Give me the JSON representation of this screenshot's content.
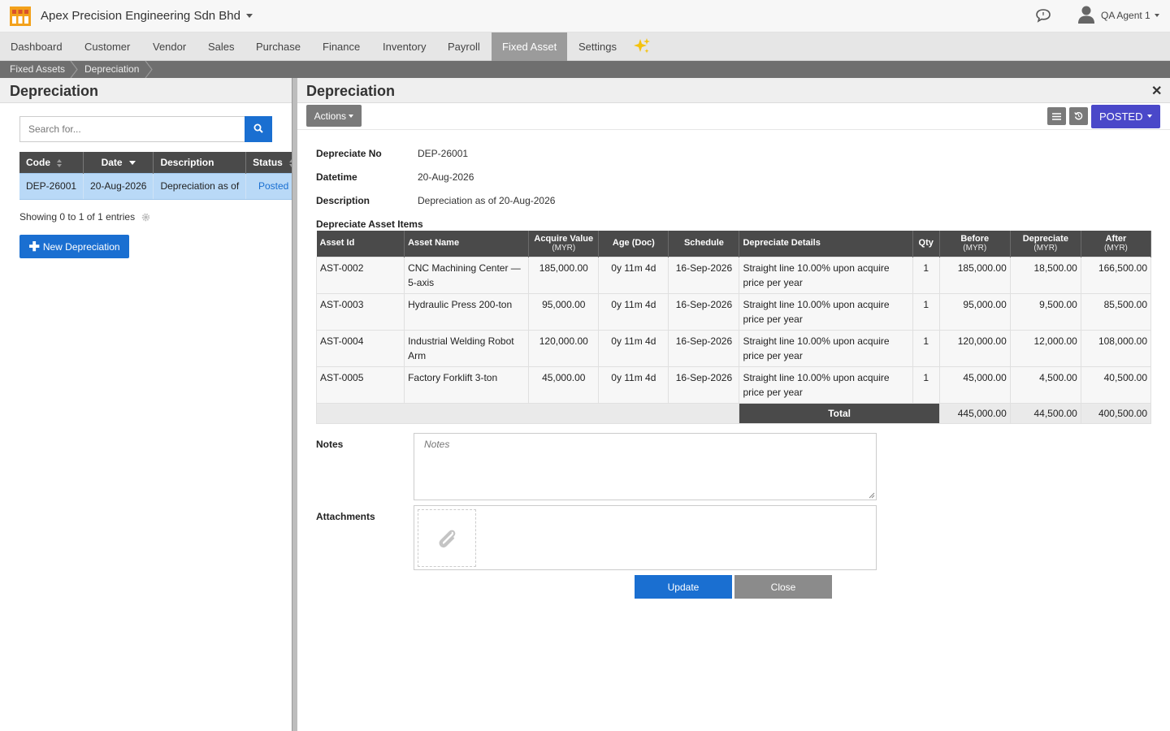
{
  "header": {
    "company": "Apex Precision Engineering Sdn Bhd",
    "user": "QA Agent 1",
    "colors": {
      "primary": "#1a6fd1",
      "posted": "#4a48c9"
    }
  },
  "nav": {
    "items": [
      "Dashboard",
      "Customer",
      "Vendor",
      "Sales",
      "Purchase",
      "Finance",
      "Inventory",
      "Payroll",
      "Fixed Asset",
      "Settings"
    ],
    "active": "Fixed Asset"
  },
  "breadcrumb": [
    "Fixed Assets",
    "Depreciation"
  ],
  "left": {
    "title": "Depreciation",
    "search_placeholder": "Search for...",
    "columns": [
      "Code",
      "Date",
      "Description",
      "Status"
    ],
    "rows": [
      {
        "code": "DEP-26001",
        "date": "20-Aug-2026",
        "description": "Depreciation as of",
        "status": "Posted"
      }
    ],
    "showing": "Showing 0 to 1 of 1 entries",
    "new_button": "New Depreciation"
  },
  "right": {
    "title": "Depreciation",
    "actions_label": "Actions",
    "status_label": "POSTED",
    "fields": {
      "no_label": "Depreciate No",
      "no_value": "DEP-26001",
      "datetime_label": "Datetime",
      "datetime_value": "20-Aug-2026",
      "desc_label": "Description",
      "desc_value": "Depreciation as of 20-Aug-2026"
    },
    "items_title": "Depreciate Asset Items",
    "columns": {
      "asset_id": "Asset Id",
      "asset_name": "Asset Name",
      "acquire": "Acquire Value",
      "acquire_unit": "(MYR)",
      "age": "Age (Doc)",
      "schedule": "Schedule",
      "details": "Depreciate Details",
      "qty": "Qty",
      "before": "Before",
      "before_unit": "(MYR)",
      "depreciate": "Depreciate",
      "depreciate_unit": "(MYR)",
      "after": "After",
      "after_unit": "(MYR)"
    },
    "items": [
      {
        "asset_id": "AST-0002",
        "name": "CNC Machining Center — 5-axis",
        "acquire": "185,000.00",
        "age": "0y 11m 4d",
        "schedule": "16-Sep-2026",
        "details": "Straight line 10.00% upon acquire price per year",
        "qty": "1",
        "before": "185,000.00",
        "depreciate": "18,500.00",
        "after": "166,500.00"
      },
      {
        "asset_id": "AST-0003",
        "name": "Hydraulic Press 200-ton",
        "acquire": "95,000.00",
        "age": "0y 11m 4d",
        "schedule": "16-Sep-2026",
        "details": "Straight line 10.00% upon acquire price per year",
        "qty": "1",
        "before": "95,000.00",
        "depreciate": "9,500.00",
        "after": "85,500.00"
      },
      {
        "asset_id": "AST-0004",
        "name": "Industrial Welding Robot Arm",
        "acquire": "120,000.00",
        "age": "0y 11m 4d",
        "schedule": "16-Sep-2026",
        "details": "Straight line 10.00% upon acquire price per year",
        "qty": "1",
        "before": "120,000.00",
        "depreciate": "12,000.00",
        "after": "108,000.00"
      },
      {
        "asset_id": "AST-0005",
        "name": "Factory Forklift 3-ton",
        "acquire": "45,000.00",
        "age": "0y 11m 4d",
        "schedule": "16-Sep-2026",
        "details": "Straight line 10.00% upon acquire price per year",
        "qty": "1",
        "before": "45,000.00",
        "depreciate": "4,500.00",
        "after": "40,500.00"
      }
    ],
    "total": {
      "label": "Total",
      "before": "445,000.00",
      "depreciate": "44,500.00",
      "after": "400,500.00"
    },
    "notes_label": "Notes",
    "notes_placeholder": "Notes",
    "attachments_label": "Attachments",
    "update_label": "Update",
    "close_label": "Close"
  }
}
